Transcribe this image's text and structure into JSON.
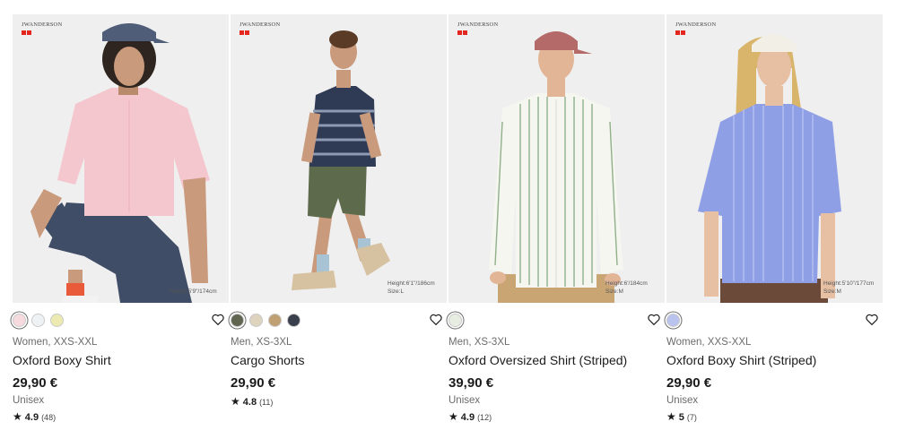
{
  "brand": {
    "wordmark": "JWANDERSON"
  },
  "products": [
    {
      "category": "Women, XXS-XXL",
      "name": "Oxford Boxy Shirt",
      "price": "29,90 €",
      "gender": "Unisex",
      "rating": "4.9",
      "review_count": "(48)",
      "model_height": "Height:5'9\"/174cm",
      "model_size": "",
      "colors": [
        "#f6dadd",
        "#eef2f5",
        "#eceab0"
      ],
      "selected_color": 0
    },
    {
      "category": "Men, XS-3XL",
      "name": "Cargo Shorts",
      "price": "29,90 €",
      "gender": "",
      "rating": "4.8",
      "review_count": "(11)",
      "model_height": "Height:6'1\"/186cm",
      "model_size": "Size:L",
      "colors": [
        "#5f6550",
        "#ddd3bf",
        "#bfa072",
        "#3a3f4d"
      ],
      "selected_color": 0
    },
    {
      "category": "Men, XS-3XL",
      "name": "Oxford Oversized Shirt (Striped)",
      "price": "39,90 €",
      "gender": "Unisex",
      "rating": "4.9",
      "review_count": "(12)",
      "model_height": "Height:6'/184cm",
      "model_size": "Size:M",
      "colors": [
        "#e8ede2"
      ],
      "selected_color": 0
    },
    {
      "category": "Women, XXS-XXL",
      "name": "Oxford Boxy Shirt (Striped)",
      "price": "29,90 €",
      "gender": "Unisex",
      "rating": "5",
      "review_count": "(7)",
      "model_height": "Height:5'10\"/177cm",
      "model_size": "Size:M",
      "colors": [
        "#b9c3ee"
      ],
      "selected_color": 0
    }
  ],
  "icons": {
    "wishlist": "heart-outline-icon",
    "rating": "star-icon"
  },
  "theme": {
    "logo_red": "#e5261f",
    "photo_bg": "#efefef"
  }
}
